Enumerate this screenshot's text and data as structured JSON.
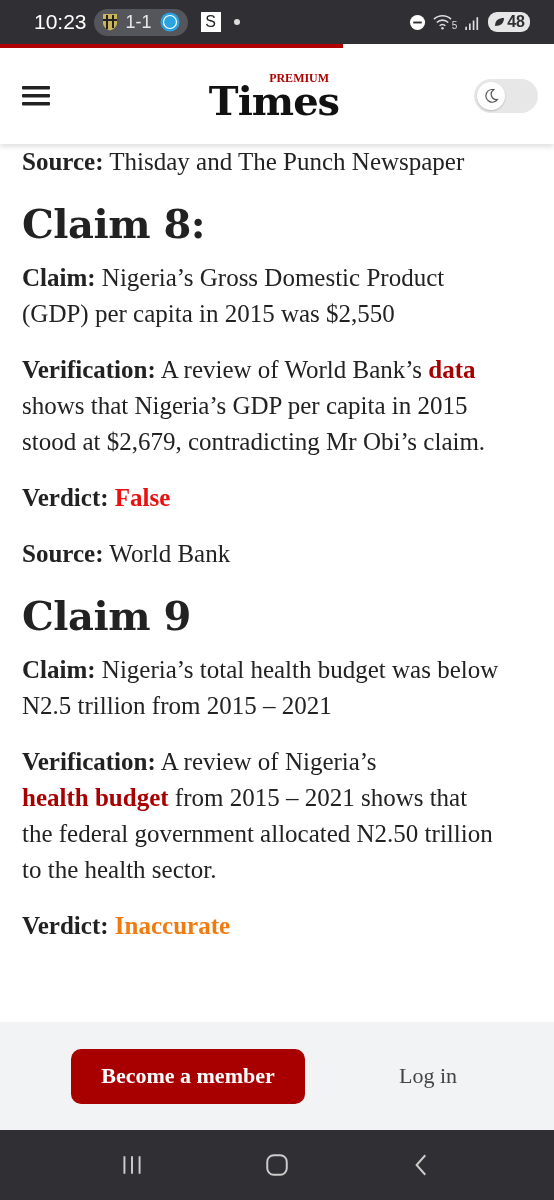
{
  "status_bar": {
    "time": "10:23",
    "score": "1-1",
    "app_badge": "S",
    "wifi_band": "5",
    "battery": "48"
  },
  "reading_progress": {
    "level": 0.62
  },
  "header": {
    "logo_small": "PREMIUM",
    "logo_main": "Times",
    "dark_mode": {
      "on": false
    }
  },
  "article": [
    {
      "kind": "cut_line",
      "parts": [
        {
          "kind": "label",
          "text": "Source:"
        },
        {
          "kind": "text",
          "text": " Thisday and The Punch Newspaper"
        }
      ]
    },
    {
      "kind": "heading",
      "text": "Claim 8:"
    },
    {
      "kind": "para",
      "parts": [
        {
          "kind": "label",
          "text": "Claim:"
        },
        {
          "kind": "text",
          "text": " Nigeria’s Gross Domestic Product (GDP) per capita in 2015 was $2,550"
        }
      ]
    },
    {
      "kind": "para",
      "parts": [
        {
          "kind": "label",
          "text": "Verification:"
        },
        {
          "kind": "text",
          "text": " A review of World Bank’s "
        },
        {
          "kind": "link",
          "text": "data"
        },
        {
          "kind": "text",
          "text": " shows that Nigeria’s GDP per capita in 2015 stood at $2,679, contradicting Mr Obi’s claim."
        }
      ]
    },
    {
      "kind": "para",
      "parts": [
        {
          "kind": "label",
          "text": "Verdict:"
        },
        {
          "kind": "verdict",
          "text": "False",
          "color": "#e8110f"
        }
      ]
    },
    {
      "kind": "para",
      "parts": [
        {
          "kind": "label",
          "text": "Source:"
        },
        {
          "kind": "text",
          "text": " World Bank"
        }
      ]
    },
    {
      "kind": "heading",
      "text": "Claim 9"
    },
    {
      "kind": "para",
      "parts": [
        {
          "kind": "label",
          "text": "Claim:"
        },
        {
          "kind": "text",
          "text": " Nigeria’s total health budget was below N2.5 trillion from 2015 – 2021"
        }
      ]
    },
    {
      "kind": "para",
      "parts": [
        {
          "kind": "label",
          "text": "Verification:"
        },
        {
          "kind": "text",
          "text": " A review of Nigeria’s "
        },
        {
          "kind": "link",
          "text": "health budget"
        },
        {
          "kind": "text",
          "text": " from 2015 – 2021 shows that the federal government allocated N2.50 trillion to the health sector."
        }
      ]
    },
    {
      "kind": "para",
      "parts": [
        {
          "kind": "label",
          "text": "Verdict:"
        },
        {
          "kind": "verdict",
          "text": "Inaccurate",
          "color": "#f07c10"
        }
      ]
    }
  ],
  "footer": {
    "member_button": "Become a member",
    "login_link": "Log in"
  }
}
